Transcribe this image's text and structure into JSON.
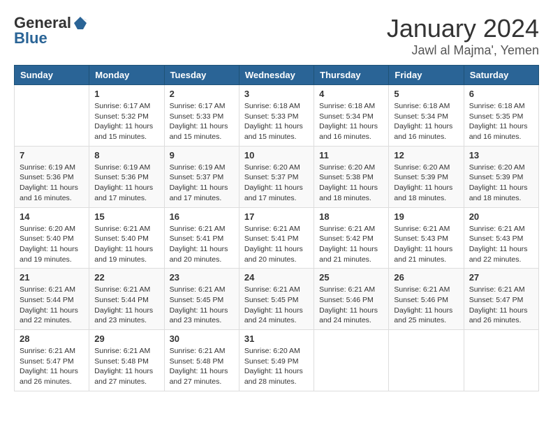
{
  "header": {
    "logo_general": "General",
    "logo_blue": "Blue",
    "month": "January 2024",
    "location": "Jawl al Majma', Yemen"
  },
  "weekdays": [
    "Sunday",
    "Monday",
    "Tuesday",
    "Wednesday",
    "Thursday",
    "Friday",
    "Saturday"
  ],
  "weeks": [
    [
      {
        "day": "",
        "info": ""
      },
      {
        "day": "1",
        "info": "Sunrise: 6:17 AM\nSunset: 5:32 PM\nDaylight: 11 hours\nand 15 minutes."
      },
      {
        "day": "2",
        "info": "Sunrise: 6:17 AM\nSunset: 5:33 PM\nDaylight: 11 hours\nand 15 minutes."
      },
      {
        "day": "3",
        "info": "Sunrise: 6:18 AM\nSunset: 5:33 PM\nDaylight: 11 hours\nand 15 minutes."
      },
      {
        "day": "4",
        "info": "Sunrise: 6:18 AM\nSunset: 5:34 PM\nDaylight: 11 hours\nand 16 minutes."
      },
      {
        "day": "5",
        "info": "Sunrise: 6:18 AM\nSunset: 5:34 PM\nDaylight: 11 hours\nand 16 minutes."
      },
      {
        "day": "6",
        "info": "Sunrise: 6:18 AM\nSunset: 5:35 PM\nDaylight: 11 hours\nand 16 minutes."
      }
    ],
    [
      {
        "day": "7",
        "info": "Sunrise: 6:19 AM\nSunset: 5:36 PM\nDaylight: 11 hours\nand 16 minutes."
      },
      {
        "day": "8",
        "info": "Sunrise: 6:19 AM\nSunset: 5:36 PM\nDaylight: 11 hours\nand 17 minutes."
      },
      {
        "day": "9",
        "info": "Sunrise: 6:19 AM\nSunset: 5:37 PM\nDaylight: 11 hours\nand 17 minutes."
      },
      {
        "day": "10",
        "info": "Sunrise: 6:20 AM\nSunset: 5:37 PM\nDaylight: 11 hours\nand 17 minutes."
      },
      {
        "day": "11",
        "info": "Sunrise: 6:20 AM\nSunset: 5:38 PM\nDaylight: 11 hours\nand 18 minutes."
      },
      {
        "day": "12",
        "info": "Sunrise: 6:20 AM\nSunset: 5:39 PM\nDaylight: 11 hours\nand 18 minutes."
      },
      {
        "day": "13",
        "info": "Sunrise: 6:20 AM\nSunset: 5:39 PM\nDaylight: 11 hours\nand 18 minutes."
      }
    ],
    [
      {
        "day": "14",
        "info": "Sunrise: 6:20 AM\nSunset: 5:40 PM\nDaylight: 11 hours\nand 19 minutes."
      },
      {
        "day": "15",
        "info": "Sunrise: 6:21 AM\nSunset: 5:40 PM\nDaylight: 11 hours\nand 19 minutes."
      },
      {
        "day": "16",
        "info": "Sunrise: 6:21 AM\nSunset: 5:41 PM\nDaylight: 11 hours\nand 20 minutes."
      },
      {
        "day": "17",
        "info": "Sunrise: 6:21 AM\nSunset: 5:41 PM\nDaylight: 11 hours\nand 20 minutes."
      },
      {
        "day": "18",
        "info": "Sunrise: 6:21 AM\nSunset: 5:42 PM\nDaylight: 11 hours\nand 21 minutes."
      },
      {
        "day": "19",
        "info": "Sunrise: 6:21 AM\nSunset: 5:43 PM\nDaylight: 11 hours\nand 21 minutes."
      },
      {
        "day": "20",
        "info": "Sunrise: 6:21 AM\nSunset: 5:43 PM\nDaylight: 11 hours\nand 22 minutes."
      }
    ],
    [
      {
        "day": "21",
        "info": "Sunrise: 6:21 AM\nSunset: 5:44 PM\nDaylight: 11 hours\nand 22 minutes."
      },
      {
        "day": "22",
        "info": "Sunrise: 6:21 AM\nSunset: 5:44 PM\nDaylight: 11 hours\nand 23 minutes."
      },
      {
        "day": "23",
        "info": "Sunrise: 6:21 AM\nSunset: 5:45 PM\nDaylight: 11 hours\nand 23 minutes."
      },
      {
        "day": "24",
        "info": "Sunrise: 6:21 AM\nSunset: 5:45 PM\nDaylight: 11 hours\nand 24 minutes."
      },
      {
        "day": "25",
        "info": "Sunrise: 6:21 AM\nSunset: 5:46 PM\nDaylight: 11 hours\nand 24 minutes."
      },
      {
        "day": "26",
        "info": "Sunrise: 6:21 AM\nSunset: 5:46 PM\nDaylight: 11 hours\nand 25 minutes."
      },
      {
        "day": "27",
        "info": "Sunrise: 6:21 AM\nSunset: 5:47 PM\nDaylight: 11 hours\nand 26 minutes."
      }
    ],
    [
      {
        "day": "28",
        "info": "Sunrise: 6:21 AM\nSunset: 5:47 PM\nDaylight: 11 hours\nand 26 minutes."
      },
      {
        "day": "29",
        "info": "Sunrise: 6:21 AM\nSunset: 5:48 PM\nDaylight: 11 hours\nand 27 minutes."
      },
      {
        "day": "30",
        "info": "Sunrise: 6:21 AM\nSunset: 5:48 PM\nDaylight: 11 hours\nand 27 minutes."
      },
      {
        "day": "31",
        "info": "Sunrise: 6:20 AM\nSunset: 5:49 PM\nDaylight: 11 hours\nand 28 minutes."
      },
      {
        "day": "",
        "info": ""
      },
      {
        "day": "",
        "info": ""
      },
      {
        "day": "",
        "info": ""
      }
    ]
  ]
}
